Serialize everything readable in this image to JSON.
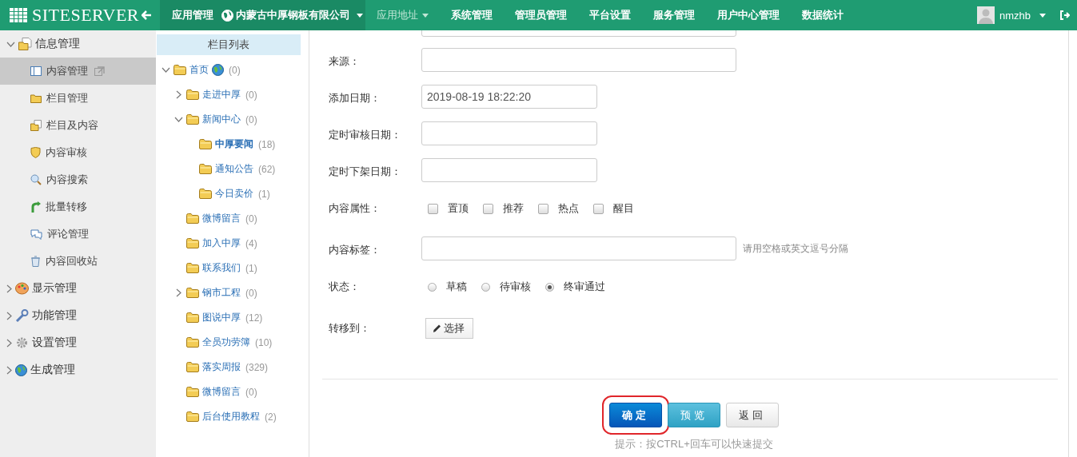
{
  "header": {
    "logo": "SITESERVER",
    "breadcrumb": {
      "app": "应用管理",
      "site": "内蒙古中厚钢板有限公司"
    },
    "nav": [
      {
        "label": "应用地址",
        "dropdown": true,
        "selected": true
      },
      {
        "label": "系统管理",
        "dropdown": false,
        "selected": false
      },
      {
        "label": "管理员管理",
        "dropdown": false,
        "selected": false
      },
      {
        "label": "平台设置",
        "dropdown": false,
        "selected": false
      },
      {
        "label": "服务管理",
        "dropdown": false,
        "selected": false
      },
      {
        "label": "用户中心管理",
        "dropdown": false,
        "selected": false
      },
      {
        "label": "数据统计",
        "dropdown": false,
        "selected": false
      }
    ],
    "user": {
      "name": "nmzhb"
    }
  },
  "sidebar": {
    "groups": [
      {
        "label": "信息管理",
        "expanded": true,
        "items": [
          {
            "label": "内容管理",
            "selected": true,
            "link_icon": true
          },
          {
            "label": "栏目管理",
            "selected": false
          },
          {
            "label": "栏目及内容",
            "selected": false
          },
          {
            "label": "内容审核",
            "selected": false
          },
          {
            "label": "内容搜索",
            "selected": false
          },
          {
            "label": "批量转移",
            "selected": false
          },
          {
            "label": "评论管理",
            "selected": false
          },
          {
            "label": "内容回收站",
            "selected": false
          }
        ]
      },
      {
        "label": "显示管理",
        "expanded": false
      },
      {
        "label": "功能管理",
        "expanded": false
      },
      {
        "label": "设置管理",
        "expanded": false
      },
      {
        "label": "生成管理",
        "expanded": false
      }
    ]
  },
  "tree": {
    "title": "栏目列表",
    "nodes": [
      {
        "label": "首页",
        "count": "(0)",
        "kind": "site",
        "expanded": true,
        "selected": false,
        "children": [
          {
            "label": "走进中厚",
            "count": "(0)",
            "expanded": false,
            "selected": false
          },
          {
            "label": "新闻中心",
            "count": "(0)",
            "expanded": true,
            "selected": false,
            "children": [
              {
                "label": "中厚要闻",
                "count": "(18)",
                "selected": true
              },
              {
                "label": "通知公告",
                "count": "(62)",
                "selected": false
              },
              {
                "label": "今日卖价",
                "count": "(1)",
                "selected": false
              }
            ]
          },
          {
            "label": "微博留言",
            "count": "(0)",
            "selected": false
          },
          {
            "label": "加入中厚",
            "count": "(4)",
            "selected": false
          },
          {
            "label": "联系我们",
            "count": "(1)",
            "selected": false
          },
          {
            "label": "钢市工程",
            "count": "(0)",
            "expanded": false,
            "selected": false
          },
          {
            "label": "图说中厚",
            "count": "(12)",
            "selected": false
          },
          {
            "label": "全员功劳簿",
            "count": "(10)",
            "selected": false
          },
          {
            "label": "落实周报",
            "count": "(329)",
            "selected": false
          },
          {
            "label": "微博留言",
            "count": "(0)",
            "selected": false
          },
          {
            "label": "后台使用教程",
            "count": "(2)",
            "selected": false
          }
        ]
      }
    ]
  },
  "form": {
    "fields": [
      {
        "kind": "text",
        "label": "来源："
      },
      {
        "kind": "date",
        "label": "添加日期：",
        "value": "2019-08-19 18:22:20"
      },
      {
        "kind": "date",
        "label": "定时审核日期："
      },
      {
        "kind": "date",
        "label": "定时下架日期："
      },
      {
        "kind": "checkboxes",
        "label": "内容属性：",
        "options": [
          {
            "label": "置顶",
            "checked": false
          },
          {
            "label": "推荐",
            "checked": false
          },
          {
            "label": "热点",
            "checked": false
          },
          {
            "label": "醒目",
            "checked": false
          }
        ]
      },
      {
        "kind": "text",
        "label": "内容标签：",
        "hint": "请用空格或英文逗号分隔"
      },
      {
        "kind": "radios",
        "label": "状态：",
        "options": [
          {
            "label": "草稿",
            "selected": false
          },
          {
            "label": "待审核",
            "selected": false
          },
          {
            "label": "终审通过",
            "selected": true
          }
        ]
      },
      {
        "kind": "button",
        "label": "转移到：",
        "button": "选择"
      }
    ],
    "actions": [
      {
        "label": "确定",
        "kind": "primary",
        "highlighted": true
      },
      {
        "label": "预览",
        "kind": "info",
        "highlighted": false
      },
      {
        "label": "返回",
        "kind": "default",
        "highlighted": false
      }
    ],
    "tip": "提示：按CTRL+回车可以快速提交"
  }
}
